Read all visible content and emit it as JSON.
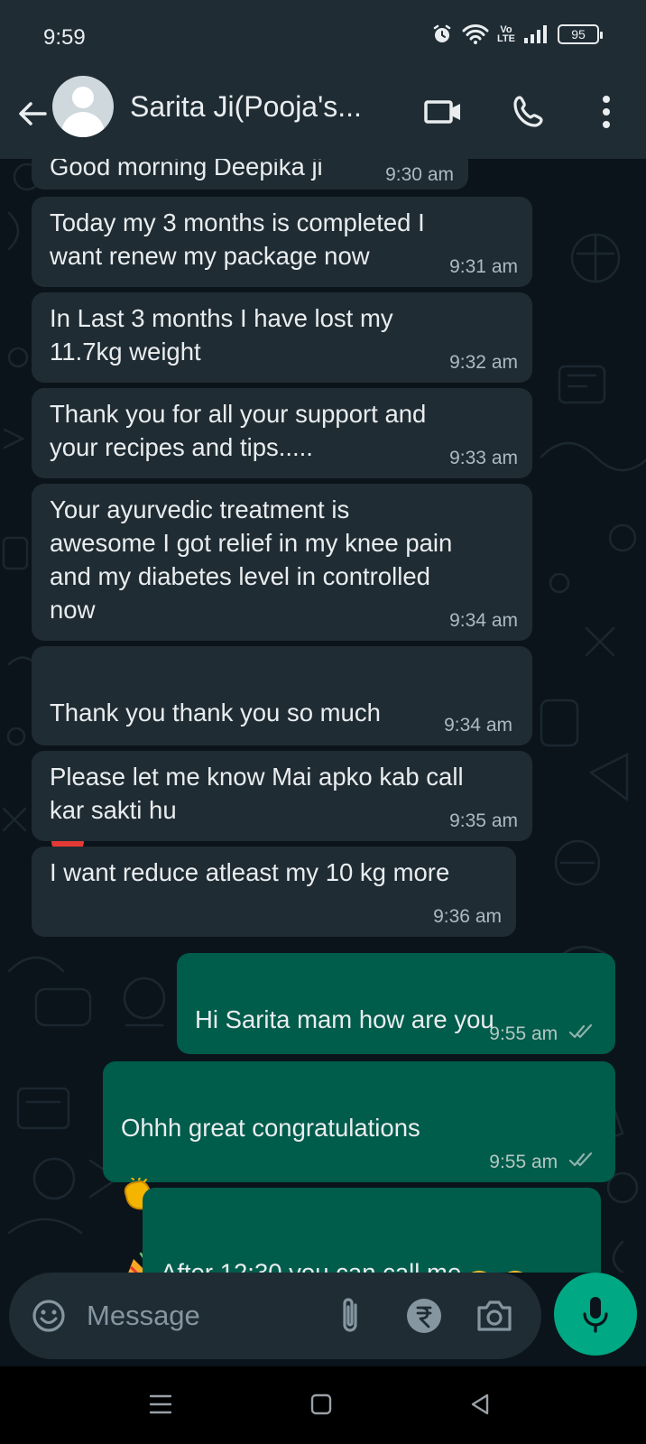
{
  "status_bar": {
    "time": "9:59",
    "network_label": "Vo LTE",
    "battery": "95"
  },
  "header": {
    "contact_name": "Sarita Ji(Pooja's..."
  },
  "messages": [
    {
      "text": "Good morning Deepika ji",
      "time": "9:30 am"
    },
    {
      "text": "Today my 3 months is completed I\nwant renew my package now",
      "time": "9:31 am"
    },
    {
      "text": "In Last 3 months I have lost my\n11.7kg weight",
      "time": "9:32 am"
    },
    {
      "text": "Thank you for all your support and\nyour recipes and tips.....",
      "time": "9:33 am"
    },
    {
      "text": "Your ayurvedic treatment is\nawesome I got relief in my knee pain\nand my diabetes level in controlled\nnow",
      "time": "9:34 am"
    },
    {
      "text": "Thank you thank you so much",
      "time": "9:34 am"
    },
    {
      "text": "Please let me know Mai apko kab call\nkar sakti hu",
      "time": "9:35 am"
    },
    {
      "text": "I want reduce atleast my 10 kg more",
      "time": "9:36 am"
    },
    {
      "text": "Hi Sarita mam  how are you",
      "time": "9:55 am"
    },
    {
      "text": "Ohhh great congratulations",
      "time": "9:55 am"
    },
    {
      "text": "After 12:30 you can call me",
      "time": ""
    }
  ],
  "input": {
    "placeholder": "Message"
  },
  "colors": {
    "accent": "#00a884",
    "incoming": "#202c33",
    "outgoing": "#005c4b",
    "background": "#0b141a",
    "header": "#1f2c34"
  },
  "icons": [
    "back-arrow-icon",
    "avatar-icon",
    "video-call-icon",
    "phone-icon",
    "more-icon",
    "emoji-icon",
    "attach-icon",
    "rupee-icon",
    "camera-icon",
    "mic-icon",
    "recents-icon",
    "home-icon",
    "back-nav-icon"
  ]
}
